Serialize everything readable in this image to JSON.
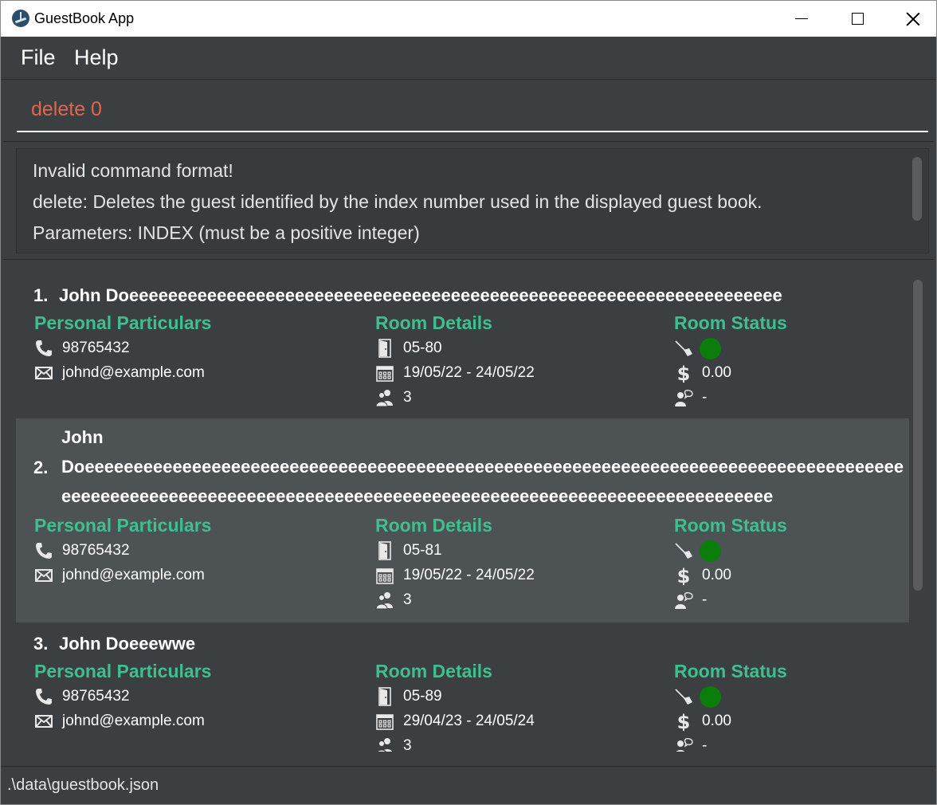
{
  "window": {
    "title": "GuestBook App"
  },
  "menu": {
    "file": "File",
    "help": "Help"
  },
  "command": {
    "value": "delete 0"
  },
  "result": {
    "lines": [
      "Invalid command format!",
      "delete: Deletes the guest identified by the index number used in the displayed guest book.",
      "Parameters: INDEX (must be a positive integer)"
    ]
  },
  "sections": {
    "personal": "Personal Particulars",
    "room": "Room Details",
    "status": "Room Status"
  },
  "guests": [
    {
      "index": "1.",
      "name_lines": [
        "John Doeeeeeeeeeeeeeeeeeeeeeeeeeeeeeeeeeeeeeeeeeeeeeeeeeeeeeeeeeeeeeeeeeee"
      ],
      "phone": "98765432",
      "email": "johnd@example.com",
      "room": "05-80",
      "dates": "19/05/22 - 24/05/22",
      "pax": "3",
      "clean": true,
      "bill": "0.00",
      "request": "-"
    },
    {
      "index": "2.",
      "name_lines": [
        "John",
        "Doeeeeeeeeeeeeeeeeeeeeeeeeeeeeeeeeeeeeeeeeeeeeeeeeeeeeeeeeeeeeeeeeeeeeeeeeeeeeeeeeeeee",
        "eeeeeeeeeeeeeeeeeeeeeeeeeeeeeeeeeeeeeeeeeeeeeeeeeeeeeeeeeeeeeeeeeeeeeeeee"
      ],
      "phone": "98765432",
      "email": "johnd@example.com",
      "room": "05-81",
      "dates": "19/05/22 - 24/05/22",
      "pax": "3",
      "clean": true,
      "bill": "0.00",
      "request": "-"
    },
    {
      "index": "3.",
      "name_lines": [
        "John Doeeewwe"
      ],
      "phone": "98765432",
      "email": "johnd@example.com",
      "room": "05-89",
      "dates": "29/04/23 - 24/05/24",
      "pax": "3",
      "clean": true,
      "bill": "0.00",
      "request": "-"
    }
  ],
  "status": {
    "file_path": ".\\data\\guestbook.json"
  },
  "colors": {
    "accent": "#3fbf8f",
    "command_text": "#e0664d",
    "clean_indicator": "#0a7d0a",
    "background": "#3c3f41",
    "selected_card": "#4d5254"
  },
  "icons": {
    "phone": "phone-icon",
    "email": "email-icon",
    "room": "door-icon",
    "dates": "calendar-icon",
    "pax": "people-icon",
    "clean": "broom-icon",
    "bill": "dollar-icon",
    "request": "request-icon"
  }
}
